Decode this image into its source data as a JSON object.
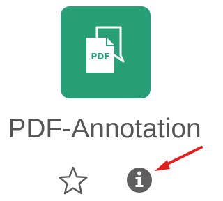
{
  "app": {
    "title": "PDF-Annotation",
    "icon_name": "pdf-annotation-icon",
    "icon_label": "PDF",
    "tile_color": "#26a074"
  },
  "actions": {
    "favorite_icon": "star-outline-icon",
    "info_icon": "info-circle-icon"
  },
  "annotation": {
    "arrow_color": "#e21d1d"
  }
}
